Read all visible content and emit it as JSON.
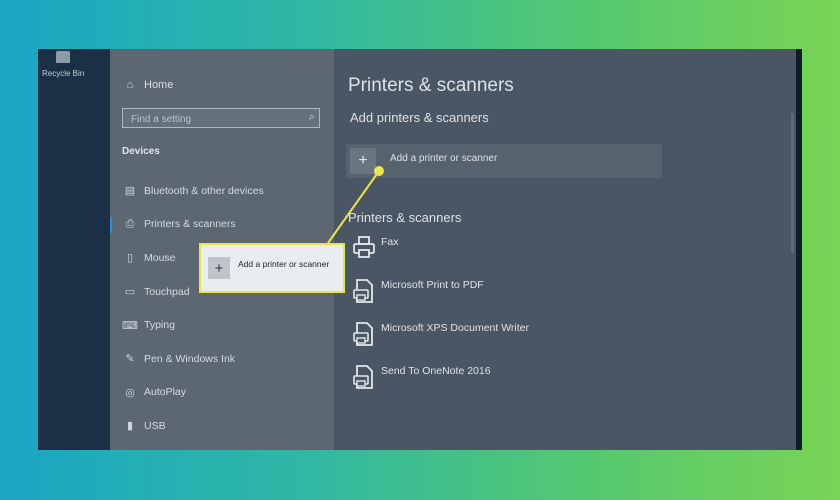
{
  "desktop": {
    "recycle_bin_label": "Recycle Bin"
  },
  "sidebar": {
    "home_label": "Home",
    "search_placeholder": "Find a setting",
    "section_title": "Devices",
    "items": [
      {
        "label": "Bluetooth & other devices",
        "icon": "bluetooth-devices-icon"
      },
      {
        "label": "Printers & scanners",
        "icon": "printer-icon",
        "active": true
      },
      {
        "label": "Mouse",
        "icon": "mouse-icon"
      },
      {
        "label": "Touchpad",
        "icon": "touchpad-icon"
      },
      {
        "label": "Typing",
        "icon": "keyboard-icon"
      },
      {
        "label": "Pen & Windows Ink",
        "icon": "pen-icon"
      },
      {
        "label": "AutoPlay",
        "icon": "autoplay-icon"
      },
      {
        "label": "USB",
        "icon": "usb-icon"
      }
    ]
  },
  "content": {
    "title": "Printers & scanners",
    "add_section_title": "Add printers & scanners",
    "add_button_label": "Add a printer or scanner",
    "list_title": "Printers & scanners",
    "printers": [
      {
        "label": "Fax",
        "icon": "fax-icon"
      },
      {
        "label": "Microsoft Print to PDF",
        "icon": "printer-document-icon"
      },
      {
        "label": "Microsoft XPS Document Writer",
        "icon": "printer-document-icon"
      },
      {
        "label": "Send To OneNote 2016",
        "icon": "printer-document-icon"
      }
    ]
  },
  "callout": {
    "label": "Add a printer or scanner"
  },
  "colors": {
    "callout_border": "#e8e44a",
    "accent": "#2d8cd8"
  }
}
